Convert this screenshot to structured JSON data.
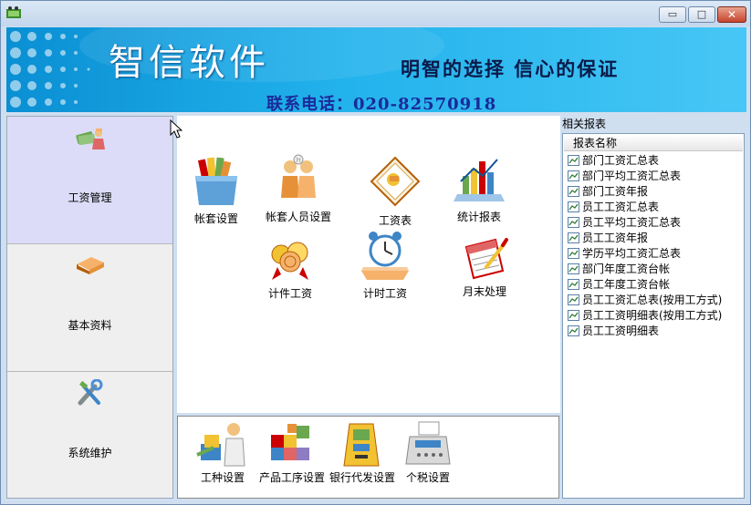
{
  "window": {
    "minimize_glyph": "▭",
    "maximize_glyph": "□",
    "close_glyph": "✕"
  },
  "banner": {
    "brand": "智信软件",
    "slogan": "明智的选择 信心的保证",
    "contact": "联系电话：020-82570918"
  },
  "nav": {
    "items": [
      {
        "label": "工资管理",
        "icon": "money-worker-icon",
        "active": true
      },
      {
        "label": "基本资料",
        "icon": "book-icon",
        "active": false
      },
      {
        "label": "系统维护",
        "icon": "tools-icon",
        "active": false
      }
    ]
  },
  "main": {
    "tiles": [
      {
        "label": "帐套设置",
        "icon": "account-box-icon"
      },
      {
        "label": "帐套人员设置",
        "icon": "people-settings-icon"
      },
      {
        "label": "工资表",
        "icon": "salary-sheet-icon"
      },
      {
        "label": "统计报表",
        "icon": "statistics-chart-icon"
      },
      {
        "label": "计件工资",
        "icon": "piecework-coins-icon"
      },
      {
        "label": "计时工资",
        "icon": "alarm-clock-icon"
      },
      {
        "label": "月末处理",
        "icon": "month-end-calendar-icon"
      }
    ]
  },
  "bottom": {
    "tiles": [
      {
        "label": "工种设置",
        "icon": "work-type-icon"
      },
      {
        "label": "产品工序设置",
        "icon": "product-process-icon"
      },
      {
        "label": "银行代发设置",
        "icon": "bank-atm-icon"
      },
      {
        "label": "个税设置",
        "icon": "tax-terminal-icon"
      }
    ]
  },
  "reports": {
    "title": "相关报表",
    "column_header": "报表名称",
    "items": [
      "部门工资汇总表",
      "部门平均工资汇总表",
      "部门工资年报",
      "员工工资汇总表",
      "员工平均工资汇总表",
      "员工工资年报",
      "学历平均工资汇总表",
      "部门年度工资台帐",
      "员工年度工资台帐",
      "员工工资汇总表(按用工方式)",
      "员工工资明细表(按用工方式)",
      "员工工资明细表"
    ]
  },
  "colors": {
    "banner_start": "#0a8fd3",
    "banner_end": "#47c7f5",
    "nav_active": "#dcdcf8",
    "nav_bg": "#efefef"
  }
}
